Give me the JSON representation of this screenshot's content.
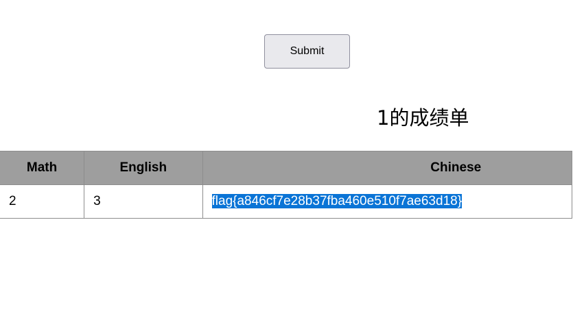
{
  "form": {
    "submit_label": "Submit"
  },
  "report": {
    "title": "1的成绩单",
    "columns": [
      "Math",
      "English",
      "Chinese"
    ],
    "rows": [
      [
        "2",
        "3",
        "flag{a846cf7e28b37fba460e510f7ae63d18}"
      ]
    ]
  },
  "colors": {
    "header_bg": "#9e9e9e",
    "selection_bg": "#0a74d6",
    "button_bg": "#e9e9ed"
  }
}
